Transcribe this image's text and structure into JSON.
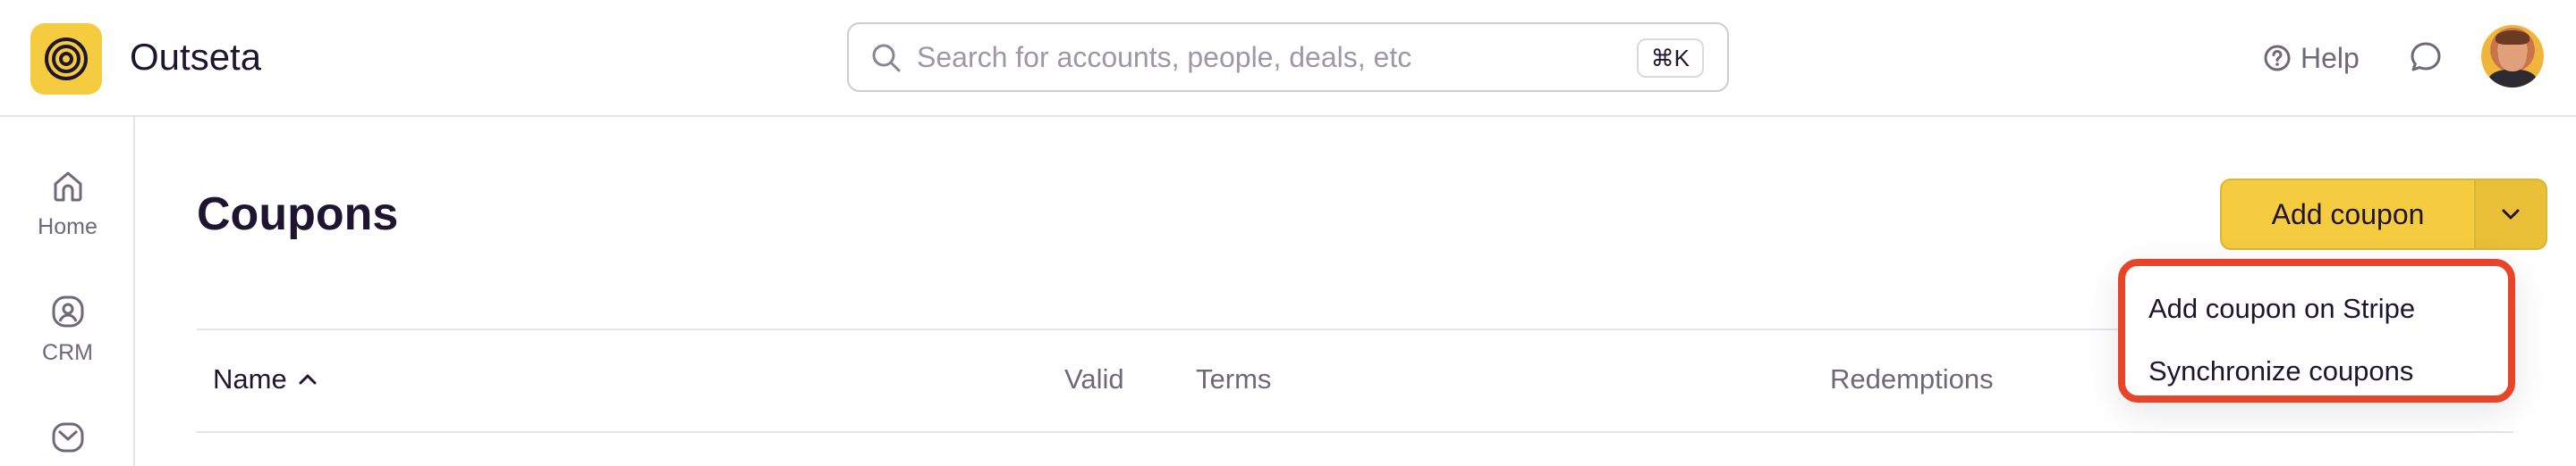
{
  "app": {
    "name": "Outseta",
    "brand_color": "#f5cc3f"
  },
  "search": {
    "placeholder": "Search for accounts, people, deals, etc",
    "value": "",
    "shortcut": "⌘K"
  },
  "header": {
    "help_label": "Help"
  },
  "sidebar": {
    "items": [
      {
        "label": "Home",
        "icon": "home-icon"
      },
      {
        "label": "CRM",
        "icon": "crm-icon"
      },
      {
        "label": "",
        "icon": "mail-icon"
      }
    ]
  },
  "page": {
    "title": "Coupons"
  },
  "toolbar": {
    "add_label": "Add coupon"
  },
  "dropdown": {
    "items": [
      {
        "label": "Add coupon on Stripe"
      },
      {
        "label": "Synchronize coupons"
      }
    ],
    "highlight_color": "#e8442a"
  },
  "table": {
    "columns": [
      {
        "label": "Name",
        "sort": "ascending"
      },
      {
        "label": "Valid"
      },
      {
        "label": "Terms"
      },
      {
        "label": "Redemptions"
      }
    ]
  }
}
